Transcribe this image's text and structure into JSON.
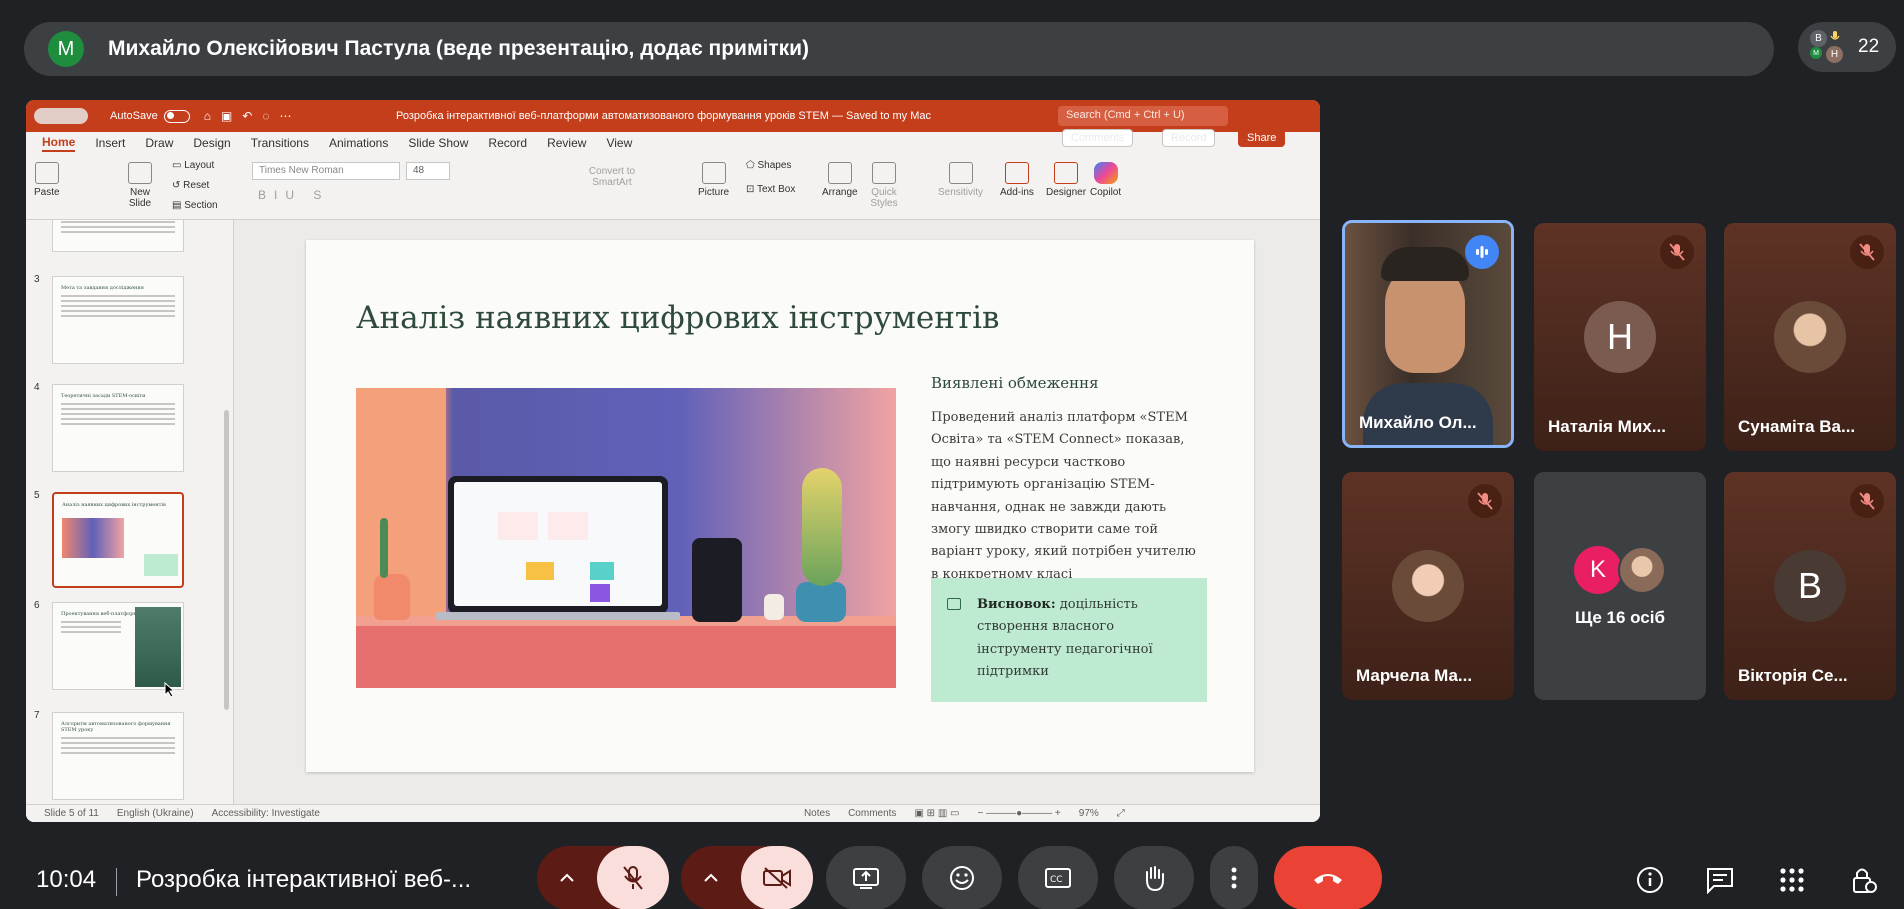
{
  "presenter_bar": {
    "avatar_letter": "М",
    "title": "Михайло Олексійович Пастула (веде презентацію, додає примітки)"
  },
  "people": {
    "mini_avatars": [
      "B",
      "H",
      "M"
    ],
    "count": "22"
  },
  "ppt": {
    "autosave_label": "AutoSave",
    "doc_title": "Розробка інтерактивної веб-платформи автоматизованого формування уроків STEM — Saved to my Mac",
    "search_placeholder": "Search (Cmd + Ctrl + U)",
    "tabs": [
      "Home",
      "Insert",
      "Draw",
      "Design",
      "Transitions",
      "Animations",
      "Slide Show",
      "Record",
      "Review",
      "View"
    ],
    "comments_label": "Comments",
    "record_label": "Record",
    "share_label": "Share",
    "ribbon": {
      "paste": "Paste",
      "new_slide": "New Slide",
      "layout": "Layout",
      "reset": "Reset",
      "section": "Section",
      "font": "Times New Roman",
      "font_size": "48",
      "convert_smartart": "Convert to SmartArt",
      "picture": "Picture",
      "shapes": "Shapes",
      "text_box": "Text Box",
      "arrange": "Arrange",
      "quick_styles": "Quick Styles",
      "sensitivity": "Sensitivity",
      "addins": "Add-ins",
      "designer": "Designer",
      "copilot": "Copilot"
    },
    "thumbnails": [
      {
        "num": "3",
        "title": "Мета та завдання дослідження"
      },
      {
        "num": "4",
        "title": "Теоретичні засади STEM-освіти"
      },
      {
        "num": "5",
        "title": "Аналіз наявних цифрових інструментів"
      },
      {
        "num": "6",
        "title": "Проектування веб-платформи"
      },
      {
        "num": "7",
        "title": "Алгоритм автоматизованого формування STEM уроку"
      }
    ],
    "slide": {
      "title": "Аналіз наявних цифрових інструментів",
      "subhead": "Виявлені обмеження",
      "body": "Проведений аналіз платформ «STEM Освіта» та «STEM Connect» показав, що наявні ресурси частково підтримують організацію STEM-навчання, однак не завжди дають змогу швидко створити саме той варіант уроку, який потрібен учителю в конкретному класі",
      "conclusion_bold": "Висновок:",
      "conclusion_text": " доцільність створення власного інструменту педагогічної підтримки"
    },
    "status": {
      "slide_of": "Slide 5 of 11",
      "language": "English (Ukraine)",
      "accessibility": "Accessibility: Investigate",
      "notes": "Notes",
      "comments": "Comments",
      "zoom": "97%"
    }
  },
  "participants": [
    {
      "name": "Михайло Ол...",
      "type": "video",
      "speaking": true
    },
    {
      "name": "Наталія Мих...",
      "type": "letter",
      "letter": "Н",
      "muted": true
    },
    {
      "name": "Сунаміта Ва...",
      "type": "photo",
      "muted": true
    },
    {
      "name": "Марчела Ма...",
      "type": "photo",
      "muted": true
    },
    {
      "name": "Ще 16 осіб",
      "type": "group",
      "letter": "K"
    },
    {
      "name": "Вікторія Се...",
      "type": "letter",
      "letter": "В",
      "muted": true
    }
  ],
  "bottom": {
    "time": "10:04",
    "meeting_title": "Розробка інтерактивної веб-..."
  },
  "colors": {
    "end_call": "#ea4335",
    "ppt_accent": "#c43e1c",
    "active_speaker": "#8ab4f8"
  }
}
